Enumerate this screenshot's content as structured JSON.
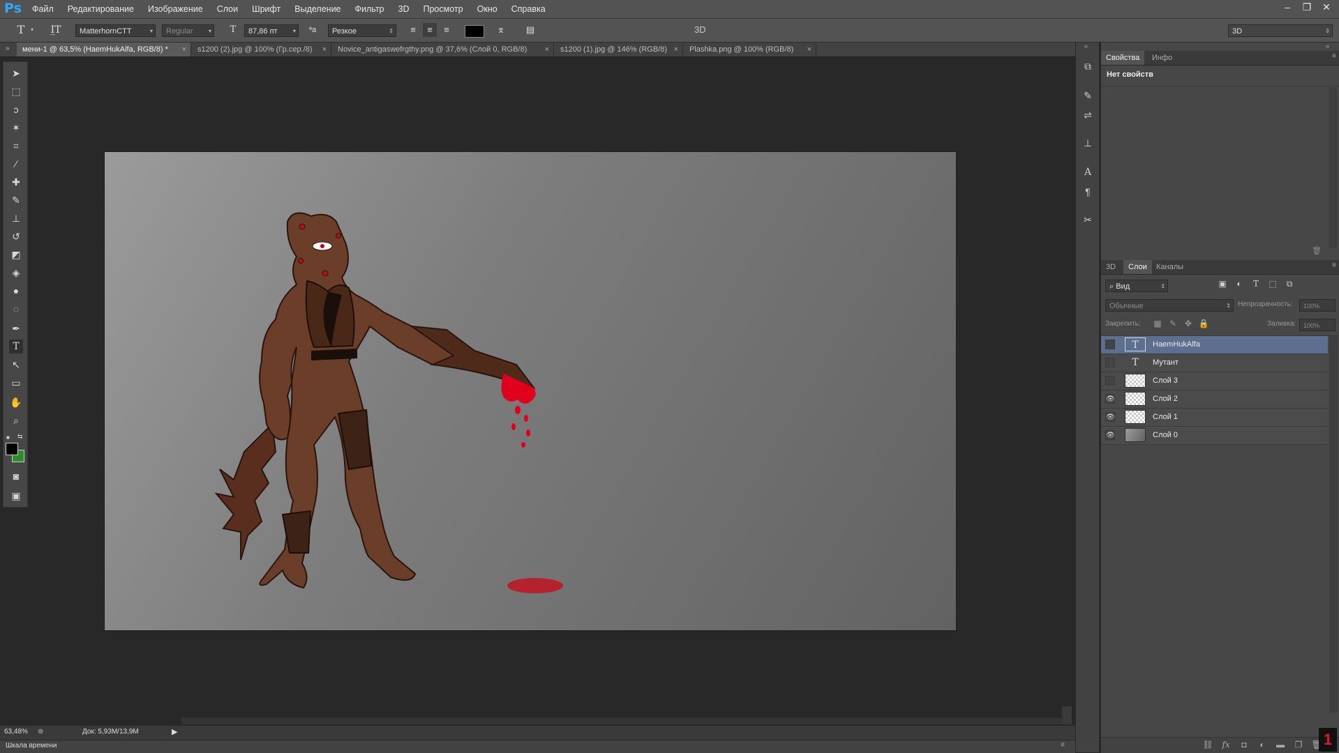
{
  "menubar": {
    "logo": "Ps",
    "items": [
      "Файл",
      "Редактирование",
      "Изображение",
      "Слои",
      "Шрифт",
      "Выделение",
      "Фильтр",
      "3D",
      "Просмотр",
      "Окно",
      "Справка"
    ],
    "window_controls": [
      "–",
      "❐",
      "✕"
    ]
  },
  "options": {
    "font_family": "MatterhornCTT",
    "font_style": "Regular",
    "font_size": "87,86 пт",
    "aa_label": "ªa",
    "antialias": "Резкое",
    "text_color": "#000000",
    "three_d_label": "3D",
    "workspace": "3D"
  },
  "tabs": [
    {
      "label": "мени-1 @ 63,5% (HaemHukAlfa, RGB/8) *",
      "active": true
    },
    {
      "label": "s1200 (2).jpg @ 100% (Гр.сер./8)",
      "active": false
    },
    {
      "label": "Novice_antigaswefrgthy.png @ 37,6% (Слой 0, RGB/8)",
      "active": false
    },
    {
      "label": "s1200 (1).jpg @ 146% (RGB/8)",
      "active": false
    },
    {
      "label": "Plashka.png @ 100% (RGB/8)",
      "active": false
    }
  ],
  "tools": [
    "move-icon",
    "marquee-icon",
    "lasso-icon",
    "magic-wand-icon",
    "crop-icon",
    "eyedropper-icon",
    "healing-icon",
    "brush-icon",
    "stamp-icon",
    "history-brush-icon",
    "eraser-icon",
    "bucket-icon",
    "blur-icon",
    "dodge-icon",
    "pen-icon",
    "type-icon",
    "path-select-icon",
    "shape-icon",
    "hand-icon",
    "zoom-icon"
  ],
  "colors": {
    "foreground": "#000000",
    "background": "#2e8b2e",
    "blood": "#e0001c",
    "skin": "#6b3e2a"
  },
  "properties_panel": {
    "tabs": [
      "Свойства",
      "Инфо"
    ],
    "empty_text": "Нет свойств"
  },
  "layers_panel": {
    "tabs": [
      "3D",
      "Слои",
      "Каналы"
    ],
    "filter": "Вид",
    "blend_mode": "Обычные",
    "opacity_label": "Непрозрачность:",
    "opacity_value": "100%",
    "lock_label": "Закрепить:",
    "fill_label": "Заливка:",
    "fill_value": "100%",
    "layers": [
      {
        "name": "HaemHukAlfa",
        "type": "text",
        "visible": false,
        "selected": true
      },
      {
        "name": "Мутант",
        "type": "text",
        "visible": false,
        "selected": false
      },
      {
        "name": "Слой 3",
        "type": "raster",
        "visible": false,
        "selected": false
      },
      {
        "name": "Слой 2",
        "type": "raster",
        "visible": true,
        "selected": false
      },
      {
        "name": "Слой 1",
        "type": "raster",
        "visible": true,
        "selected": false
      },
      {
        "name": "Слой 0",
        "type": "fill",
        "visible": true,
        "selected": false
      }
    ]
  },
  "status": {
    "zoom": "63,48%",
    "doc": "Док: 5,93M/13,9M",
    "timeline": "Шкала времени"
  }
}
